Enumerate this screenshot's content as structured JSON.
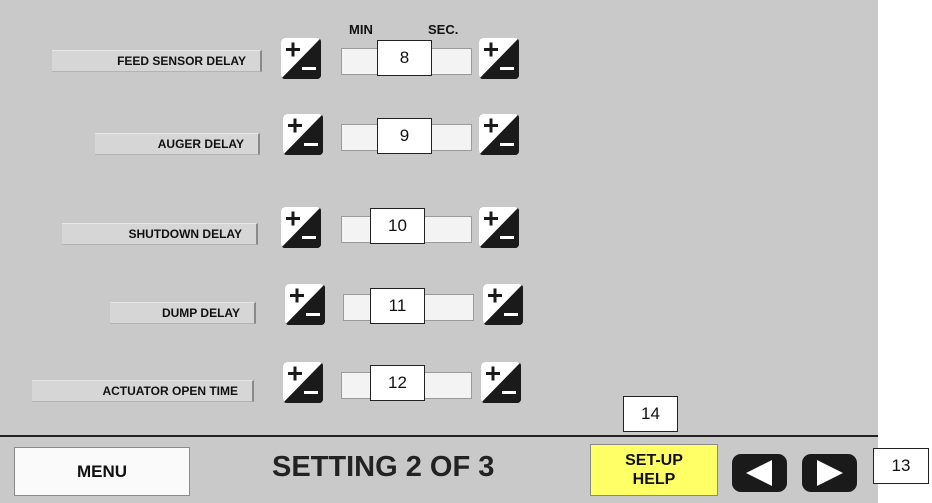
{
  "header": {
    "min_label": "MIN",
    "sec_label": "SEC."
  },
  "rows": [
    {
      "label": "FEED SENSOR DELAY",
      "callout": "8"
    },
    {
      "label": "AUGER DELAY",
      "callout": "9"
    },
    {
      "label": "SHUTDOWN DELAY",
      "callout": "10"
    },
    {
      "label": "DUMP DELAY",
      "callout": "11"
    },
    {
      "label": "ACTUATOR OPEN TIME",
      "callout": "12"
    }
  ],
  "footer": {
    "menu_label": "MENU",
    "screen_title": "SETTING 2 OF 3",
    "help_line1": "SET-UP",
    "help_line2": "HELP",
    "help_callout": "14",
    "nav_callout": "13"
  },
  "icons": {
    "plus_minus": "plus-minus-icon",
    "prev": "prev-arrow-icon",
    "next": "next-arrow-icon"
  },
  "colors": {
    "panel_bg": "#c9c9c9",
    "help_button_bg": "#ffff66",
    "button_dark": "#1a1a1a"
  }
}
